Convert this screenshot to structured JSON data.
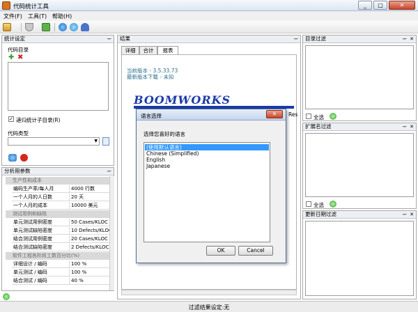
{
  "window": {
    "title": "代码统计工具",
    "minimize": "_",
    "maximize": "□",
    "close": "✕"
  },
  "menu": [
    "文件(F)",
    "工具(T)",
    "帮助(H)"
  ],
  "toolbar": {
    "icons": [
      "report-icon",
      "filter-icon",
      "tree-icon",
      "globe-icon",
      "refresh-icon",
      "help-icon"
    ]
  },
  "panels": {
    "stats_settings": {
      "title": "统计设定",
      "code_dir_label": "代码目录",
      "recursive_label": "递归统计子目录(R)",
      "code_type_label": "代码类型",
      "code_type_value": ""
    },
    "analysis_params": {
      "title": "分析用参数",
      "rows": [
        {
          "type": "category",
          "label": "生产性和成本"
        },
        {
          "type": "row",
          "key": "编码生产率/每人月",
          "value": "4000 行数"
        },
        {
          "type": "row",
          "key": "一个人月的人日数",
          "value": "20 天"
        },
        {
          "type": "row",
          "key": "一个人月的成本",
          "value": "10000 美元"
        },
        {
          "type": "category",
          "label": "测试用例和缺陷"
        },
        {
          "type": "row",
          "key": "单元测试用例密度",
          "value": "50 Cases/KLOC"
        },
        {
          "type": "row",
          "key": "单元测试缺陷密度",
          "value": "10 Defects/KLOC"
        },
        {
          "type": "row",
          "key": "结合测试用例密度",
          "value": "20 Cases/KLOC"
        },
        {
          "type": "row",
          "key": "结合测试缺陷密度",
          "value": "2 Defects/KLOC"
        },
        {
          "type": "category",
          "label": "软件工程各阶段工数百分比(%)"
        },
        {
          "type": "row",
          "key": "详细设计 / 编码",
          "value": "100 %"
        },
        {
          "type": "row",
          "key": "单元测试 / 编码",
          "value": "100 %"
        },
        {
          "type": "row",
          "key": "结合测试 / 编码",
          "value": "40 %"
        }
      ]
    },
    "result": {
      "title": "结果",
      "tabs": [
        "详细",
        "合计",
        "报表"
      ],
      "active_tab": 2,
      "current_version": "当前版本 - 3.5.33.73",
      "latest_version": "最新版本下载 - 未知",
      "logo": "BOOMWORKS",
      "side_text": "Res"
    },
    "dir_filter": {
      "title": "目录过滤",
      "select_all": "全选"
    },
    "ext_filter": {
      "title": "扩展名过滤",
      "select_all": "全选"
    },
    "date_filter": {
      "title": "更新日期过滤"
    }
  },
  "dialog": {
    "title": "语言选择",
    "prompt": "选择您喜好的语言",
    "options": [
      "(使用默认语言)",
      "Chinese (Simplified)",
      "English",
      "Japanese"
    ],
    "selected_index": 0,
    "ok": "OK",
    "cancel": "Cancel"
  },
  "status": "过滤结果设定:无"
}
